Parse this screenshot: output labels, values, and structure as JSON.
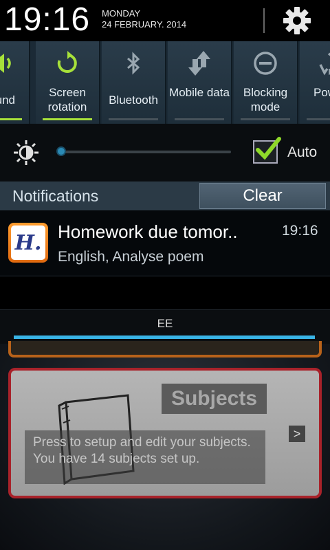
{
  "status": {
    "time": "19:16",
    "day": "MONDAY",
    "date": "24 FEBRUARY. 2014"
  },
  "toggles": [
    {
      "label": "und",
      "icon": "sound-icon",
      "active": true
    },
    {
      "label": "Screen rotation",
      "icon": "screen-rotation-icon",
      "active": true
    },
    {
      "label": "Bluetooth",
      "icon": "bluetooth-icon",
      "active": false
    },
    {
      "label": "Mobile data",
      "icon": "mobile-data-icon",
      "active": false
    },
    {
      "label": "Blocking mode",
      "icon": "blocking-mode-icon",
      "active": false
    },
    {
      "label": "Pow sav",
      "icon": "power-saving-icon",
      "active": false
    }
  ],
  "brightness": {
    "auto_label": "Auto",
    "auto_checked": true,
    "level": 0.0
  },
  "notifications": {
    "title": "Notifications",
    "clear_label": "Clear",
    "items": [
      {
        "app_icon_letter": "H.",
        "title": "Homework due tomor..",
        "time": "19:16",
        "text": "English, Analyse poem"
      }
    ]
  },
  "carrier": {
    "name": "EE"
  },
  "background_app": {
    "card_title": "Subjects",
    "card_text": "Press to setup and edit your subjects. You have 14 subjects set up.",
    "arrow": ">"
  },
  "colors": {
    "toggle_active": "#a7e13a",
    "carrier_line": "#39b4e6",
    "subjects_border": "#a8222a",
    "app_icon": "#ff8c1a"
  }
}
